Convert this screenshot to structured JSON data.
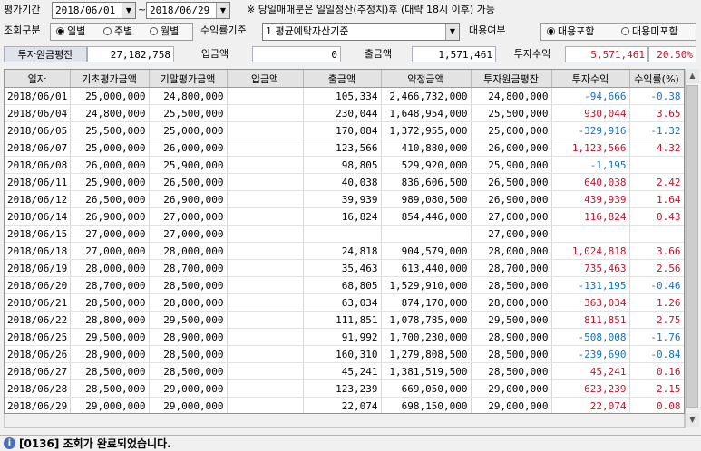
{
  "filter": {
    "period_label": "평가기간",
    "start_date": "2018/06/01",
    "tilde": "~",
    "end_date": "2018/06/29",
    "note": "※ 당일매매분은 일일정산(추정치)후 (대략 18시 이후) 가능",
    "query_type_label": "조회구분",
    "query_options": [
      "일별",
      "주별",
      "월별"
    ],
    "query_selected": 0,
    "return_basis_label": "수익률기준",
    "return_basis_value": "1 평균예탁자산기준",
    "loan_label": "대용여부",
    "loan_options": [
      "대용포함",
      "대용미포함"
    ],
    "loan_selected": 0
  },
  "summary": {
    "avg_principal_label": "투자원금평잔",
    "avg_principal_value": "27,182,758",
    "deposit_label": "입금액",
    "deposit_value": "0",
    "withdraw_label": "출금액",
    "withdraw_value": "1,571,461",
    "profit_label": "투자수익",
    "profit_value": "5,571,461",
    "rate_value": "20.50%"
  },
  "table": {
    "headers": [
      "일자",
      "기초평가금액",
      "기말평가금액",
      "입금액",
      "출금액",
      "약정금액",
      "투자원금평잔",
      "투자수익",
      "수익률(%)"
    ],
    "rows": [
      [
        "2018/06/01",
        "25,000,000",
        "24,800,000",
        "",
        "105,334",
        "2,466,732,000",
        "24,800,000",
        "-94,666",
        "-0.38"
      ],
      [
        "2018/06/04",
        "24,800,000",
        "25,500,000",
        "",
        "230,044",
        "1,648,954,000",
        "25,500,000",
        "930,044",
        "3.65"
      ],
      [
        "2018/06/05",
        "25,500,000",
        "25,000,000",
        "",
        "170,084",
        "1,372,955,000",
        "25,000,000",
        "-329,916",
        "-1.32"
      ],
      [
        "2018/06/07",
        "25,000,000",
        "26,000,000",
        "",
        "123,566",
        "410,880,000",
        "26,000,000",
        "1,123,566",
        "4.32"
      ],
      [
        "2018/06/08",
        "26,000,000",
        "25,900,000",
        "",
        "98,805",
        "529,920,000",
        "25,900,000",
        "-1,195",
        ""
      ],
      [
        "2018/06/11",
        "25,900,000",
        "26,500,000",
        "",
        "40,038",
        "836,606,500",
        "26,500,000",
        "640,038",
        "2.42"
      ],
      [
        "2018/06/12",
        "26,500,000",
        "26,900,000",
        "",
        "39,939",
        "989,080,500",
        "26,900,000",
        "439,939",
        "1.64"
      ],
      [
        "2018/06/14",
        "26,900,000",
        "27,000,000",
        "",
        "16,824",
        "854,446,000",
        "27,000,000",
        "116,824",
        "0.43"
      ],
      [
        "2018/06/15",
        "27,000,000",
        "27,000,000",
        "",
        "",
        "",
        "27,000,000",
        "",
        ""
      ],
      [
        "2018/06/18",
        "27,000,000",
        "28,000,000",
        "",
        "24,818",
        "904,579,000",
        "28,000,000",
        "1,024,818",
        "3.66"
      ],
      [
        "2018/06/19",
        "28,000,000",
        "28,700,000",
        "",
        "35,463",
        "613,440,000",
        "28,700,000",
        "735,463",
        "2.56"
      ],
      [
        "2018/06/20",
        "28,700,000",
        "28,500,000",
        "",
        "68,805",
        "1,529,910,000",
        "28,500,000",
        "-131,195",
        "-0.46"
      ],
      [
        "2018/06/21",
        "28,500,000",
        "28,800,000",
        "",
        "63,034",
        "874,170,000",
        "28,800,000",
        "363,034",
        "1.26"
      ],
      [
        "2018/06/22",
        "28,800,000",
        "29,500,000",
        "",
        "111,851",
        "1,078,785,000",
        "29,500,000",
        "811,851",
        "2.75"
      ],
      [
        "2018/06/25",
        "29,500,000",
        "28,900,000",
        "",
        "91,992",
        "1,700,230,000",
        "28,900,000",
        "-508,008",
        "-1.76"
      ],
      [
        "2018/06/26",
        "28,900,000",
        "28,500,000",
        "",
        "160,310",
        "1,279,808,500",
        "28,500,000",
        "-239,690",
        "-0.84"
      ],
      [
        "2018/06/27",
        "28,500,000",
        "28,500,000",
        "",
        "45,241",
        "1,381,519,500",
        "28,500,000",
        "45,241",
        "0.16"
      ],
      [
        "2018/06/28",
        "28,500,000",
        "29,000,000",
        "",
        "123,239",
        "669,050,000",
        "29,000,000",
        "623,239",
        "2.15"
      ],
      [
        "2018/06/29",
        "29,000,000",
        "29,000,000",
        "",
        "22,074",
        "698,150,000",
        "29,000,000",
        "22,074",
        "0.08"
      ]
    ]
  },
  "status": {
    "icon": "info-icon",
    "message": "[0136] 조회가 완료되었습니다."
  },
  "colors": {
    "negative": "#1070c8",
    "positive": "#c0142c"
  }
}
